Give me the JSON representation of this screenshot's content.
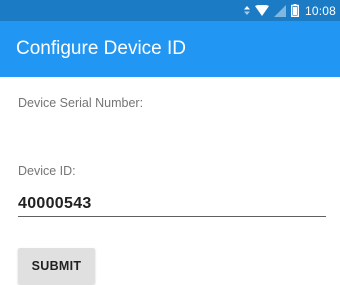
{
  "status_bar": {
    "time": "10:08",
    "icons": [
      "data-arrows-icon",
      "wifi-icon",
      "no-sim-icon",
      "battery-icon"
    ]
  },
  "app_bar": {
    "title": "Configure Device ID",
    "color": "#2196f3",
    "status_color": "#1b7bc4"
  },
  "form": {
    "serial_label": "Device Serial Number:",
    "device_id_label": "Device ID:",
    "device_id_value": "40000543",
    "submit_label": "SUBMIT"
  }
}
